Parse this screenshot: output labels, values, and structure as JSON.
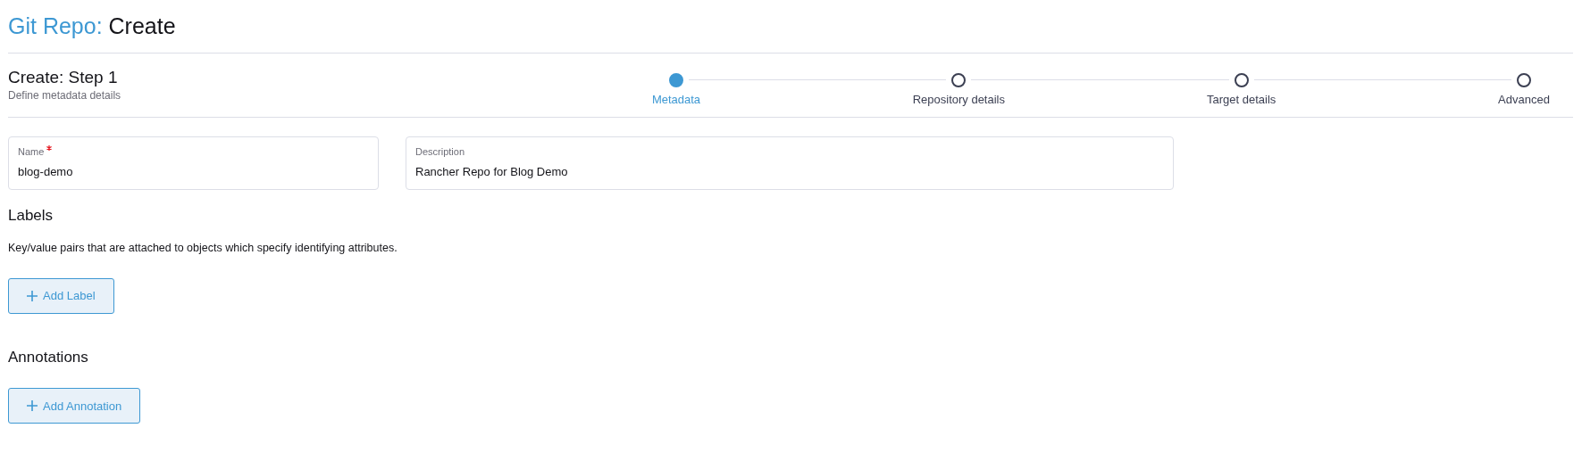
{
  "header": {
    "resource": "Git Repo:",
    "action": "Create"
  },
  "wizard": {
    "title": "Create: Step 1",
    "subtitle": "Define metadata details",
    "steps": [
      {
        "label": "Metadata",
        "selected": true
      },
      {
        "label": "Repository details",
        "selected": false
      },
      {
        "label": "Target details",
        "selected": false
      },
      {
        "label": "Advanced",
        "selected": false
      }
    ]
  },
  "fields": [
    {
      "label": "Name",
      "required": true,
      "value": "blog-demo"
    },
    {
      "label": "Description",
      "required": false,
      "value": "Rancher Repo for Blog Demo"
    }
  ],
  "sections": [
    {
      "title": "Labels",
      "description": "Key/value pairs that are attached to objects which specify identifying attributes.",
      "button": "Add Label"
    },
    {
      "title": "Annotations",
      "button": "Add Annotation"
    }
  ]
}
